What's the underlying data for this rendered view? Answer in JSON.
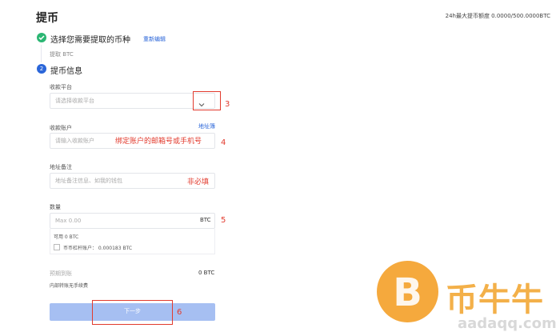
{
  "page": {
    "title": "提币",
    "limit_text": "24h最大提币额度 0.0000/500.0000BTC"
  },
  "step1": {
    "label": "选择您需要提取的币种",
    "reselect": "重新编辑",
    "picked": "提取 BTC"
  },
  "step2": {
    "number": "2",
    "label": "提币信息"
  },
  "platform": {
    "label": "收款平台",
    "placeholder": "请选择收款平台",
    "annotation": "3"
  },
  "account": {
    "label": "收款账户",
    "address_book": "地址簿",
    "placeholder": "请输入收款账户",
    "hint": "绑定账户的邮箱号或手机号",
    "annotation": "4"
  },
  "memo": {
    "label": "地址备注",
    "placeholder": "地址备注信息、如我的钱包",
    "hint": "非必填"
  },
  "amount": {
    "label": "数量",
    "placeholder": "Max 0.00",
    "unit": "BTC",
    "annotation": "5",
    "available": "可用   0 BTC",
    "margin_account": "币币杠杆账户：   0.000183 BTC"
  },
  "arrival": {
    "label": "预期到账",
    "value": "0 BTC",
    "fee_note": "内部转账无手续费"
  },
  "next": {
    "label": "下一步",
    "annotation": "6"
  },
  "watermark": {
    "logo_letter": "B",
    "text": "币牛牛",
    "url": "aadaqq.com"
  },
  "colors": {
    "accent": "#2b66d9",
    "success": "#2bb673",
    "annotation_red": "#e23b2e",
    "button_disabled": "#a6bff2",
    "watermark_orange": "#f39a1b"
  },
  "icons": {
    "step1": "check-circle-icon",
    "dropdown": "chevron-down-icon",
    "watermark": "bitcoin-logo-icon"
  }
}
